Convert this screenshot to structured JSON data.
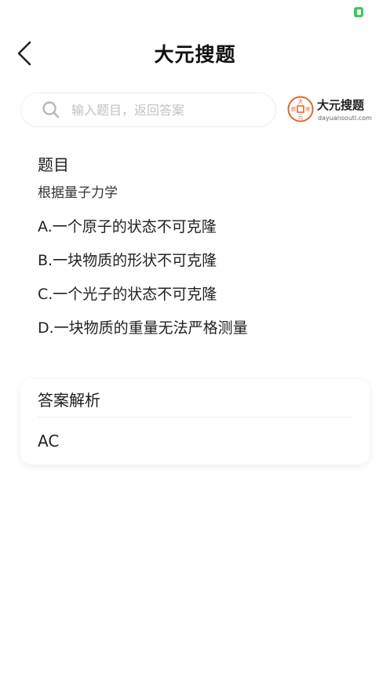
{
  "header": {
    "title": "大元搜题",
    "back_icon": "chevron-left-icon"
  },
  "search": {
    "placeholder": "输入题目，返回答案",
    "icon": "search-icon"
  },
  "brand": {
    "name": "大元搜题",
    "url": "dayuansouti.com",
    "seal_chars": [
      "大",
      "题",
      "搜",
      "元"
    ],
    "accent_color": "#e0682d"
  },
  "status_bar": {
    "battery_color": "#3cc85a"
  },
  "question": {
    "heading": "题目",
    "text": "根据量子力学",
    "options": [
      "A.一个原子的状态不可克隆",
      "B.一块物质的形状不可克隆",
      "C.一个光子的状态不可克隆",
      "D.一块物质的重量无法严格测量"
    ]
  },
  "answer": {
    "heading": "答案解析",
    "value": "AC"
  }
}
